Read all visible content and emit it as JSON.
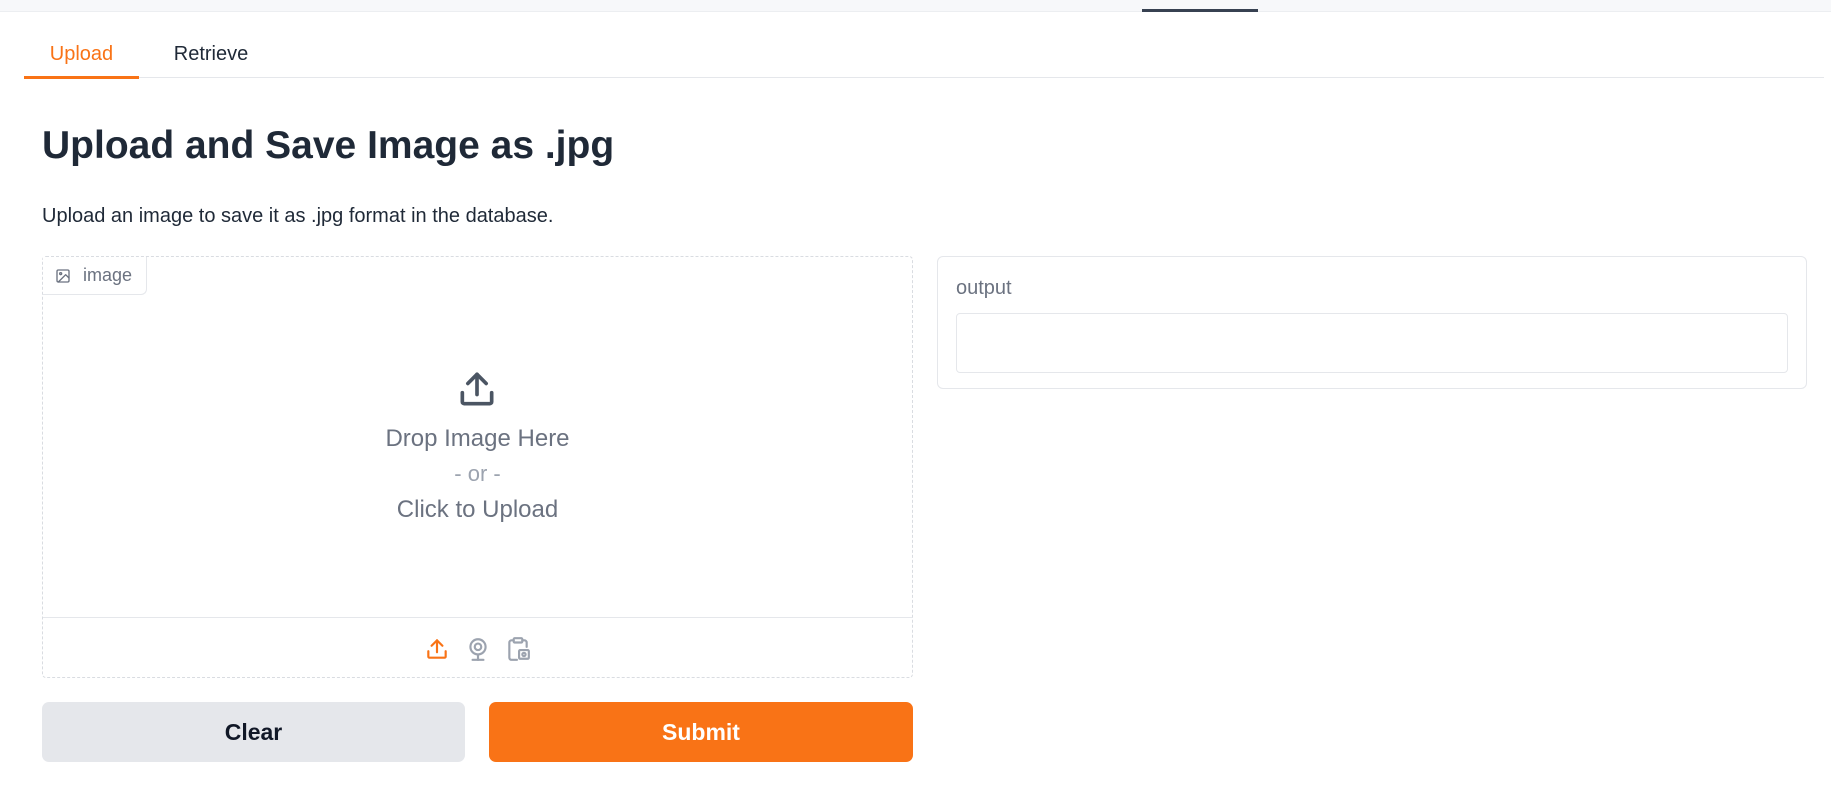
{
  "tabs": [
    {
      "label": "Upload",
      "active": true
    },
    {
      "label": "Retrieve",
      "active": false
    }
  ],
  "page": {
    "title": "Upload and Save Image as .jpg",
    "description": "Upload an image to save it as .jpg format in the database."
  },
  "image_input": {
    "label": "image",
    "label_icon": "image-icon",
    "drop_main": "Drop Image Here",
    "drop_or": "- or -",
    "drop_click": "Click to Upload",
    "sources": [
      "upload-icon",
      "webcam-icon",
      "clipboard-icon"
    ]
  },
  "buttons": {
    "clear": "Clear",
    "submit": "Submit"
  },
  "output": {
    "label": "output",
    "value": ""
  },
  "colors": {
    "accent": "#f97316",
    "secondary_button": "#e5e7eb",
    "muted_text": "#6b7280"
  }
}
